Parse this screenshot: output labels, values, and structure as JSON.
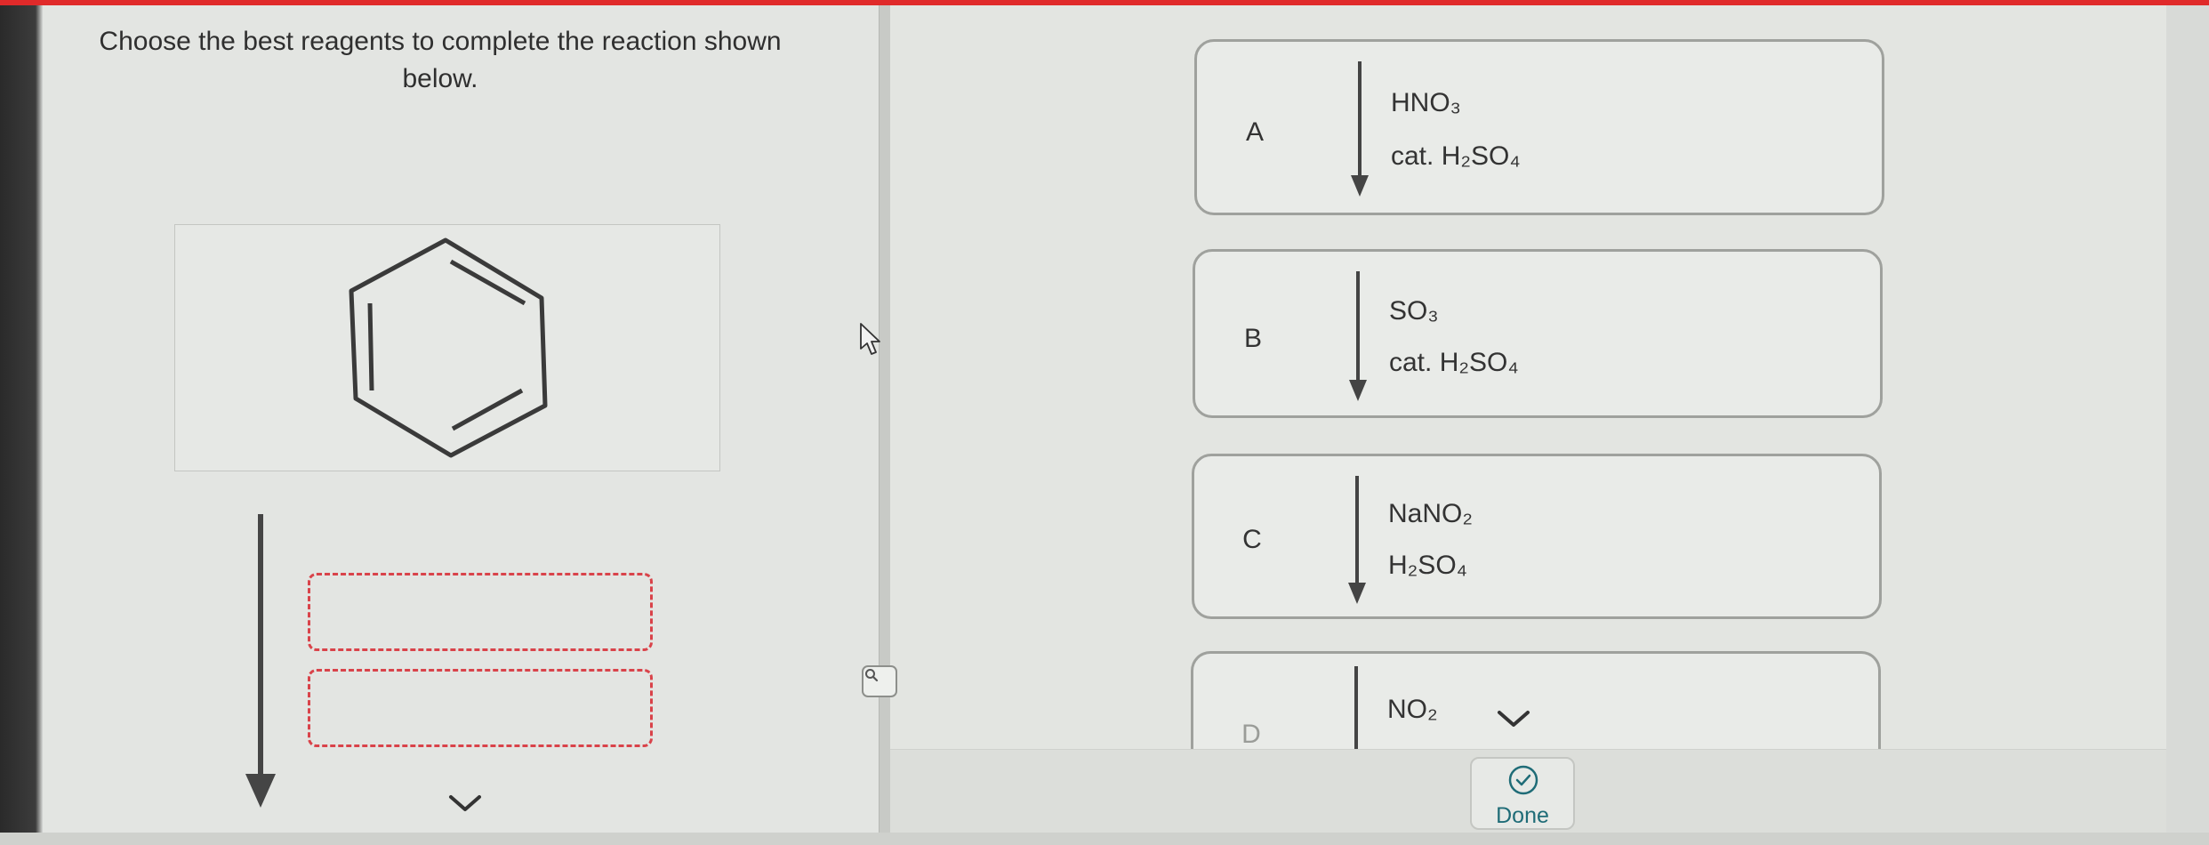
{
  "question": {
    "line1": "Choose the best reagents to complete the reaction shown",
    "line2": "below."
  },
  "options": [
    {
      "letter": "A",
      "reagent_1": "HNO₃",
      "reagent_2": "cat. H₂SO₄"
    },
    {
      "letter": "B",
      "reagent_1": "SO₃",
      "reagent_2": "cat. H₂SO₄"
    },
    {
      "letter": "C",
      "reagent_1": "NaNO₂",
      "reagent_2": "H₂SO₄"
    },
    {
      "letter": "D",
      "reagent_1": "NO₂",
      "reagent_2": ""
    }
  ],
  "done_label": "Done",
  "icons": {
    "zoom": "magnifier-icon",
    "scroll_hint": "chevron-down-icon",
    "done": "check-circle-icon",
    "pointer": "mouse-cursor-icon"
  },
  "colors": {
    "top_bar": "#e02a2a",
    "drop_slot_border": "#d9434a",
    "done_accent": "#1f6c77"
  }
}
